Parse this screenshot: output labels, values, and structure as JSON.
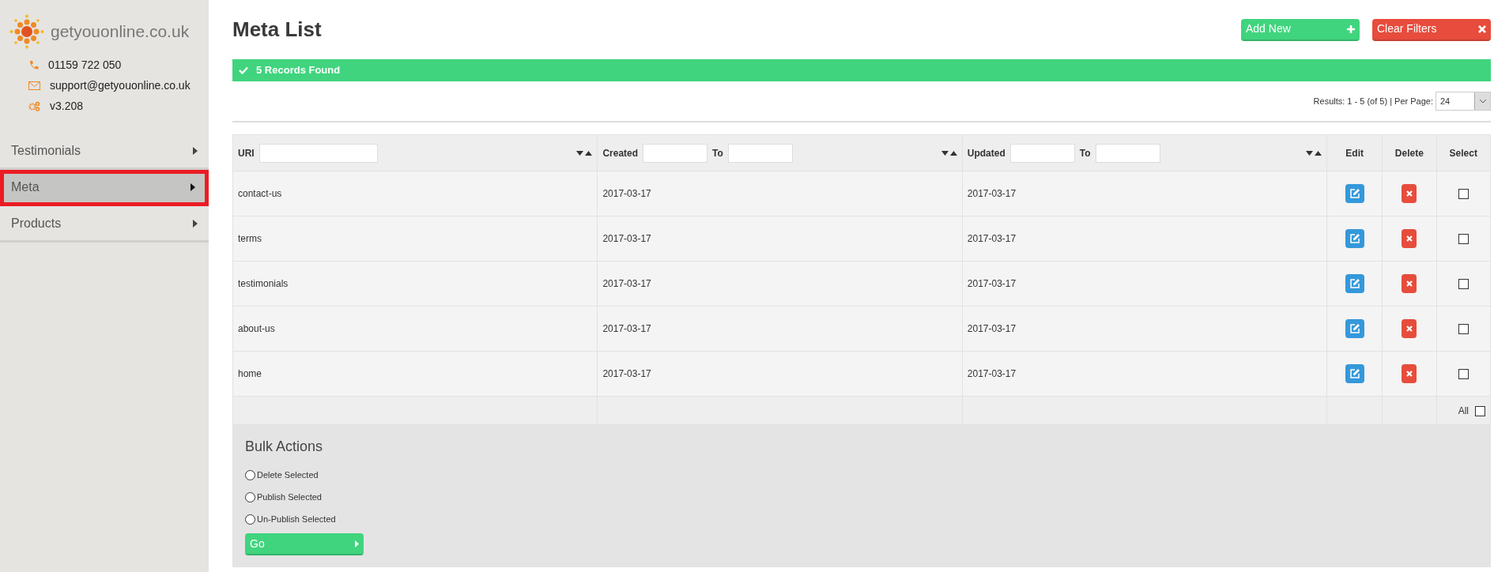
{
  "sidebar": {
    "brand": "getyouonline.co.uk",
    "contacts": [
      {
        "kind": "phone",
        "text": "01159 722 050"
      },
      {
        "kind": "email",
        "text": "support@getyouonline.co.uk"
      },
      {
        "kind": "version",
        "text": "v3.208"
      }
    ],
    "items": [
      {
        "label": "Testimonials",
        "selected": false
      },
      {
        "label": "Meta",
        "selected": true
      },
      {
        "label": "Products",
        "selected": false
      }
    ]
  },
  "header": {
    "title": "Meta List",
    "buttons": [
      {
        "kind": "add",
        "label": "Add New"
      },
      {
        "kind": "clear",
        "label": "Clear Filters"
      }
    ],
    "alert": "5 Records Found",
    "results": "Results: 1 - 5 (of 5) | Per Page:",
    "per_page": "24"
  },
  "table": {
    "columns": [
      {
        "kind": "filter",
        "label": "URI"
      },
      {
        "kind": "range",
        "label": "Created",
        "to_label": "To"
      },
      {
        "kind": "range",
        "label": "Updated",
        "to_label": "To"
      },
      {
        "kind": "action",
        "label": "Edit"
      },
      {
        "kind": "action",
        "label": "Delete"
      },
      {
        "kind": "action",
        "label": "Select"
      }
    ],
    "rows": [
      {
        "uri": "contact-us",
        "created": "2017-03-17",
        "updated": "2017-03-17",
        "checked": false
      },
      {
        "uri": "terms",
        "created": "2017-03-17",
        "updated": "2017-03-17",
        "checked": false
      },
      {
        "uri": "testimonials",
        "created": "2017-03-17",
        "updated": "2017-03-17",
        "checked": false
      },
      {
        "uri": "about-us",
        "created": "2017-03-17",
        "updated": "2017-03-17",
        "checked": false
      },
      {
        "uri": "home",
        "created": "2017-03-17",
        "updated": "2017-03-17",
        "checked": false
      }
    ],
    "footer": {
      "all_label": "All",
      "all_checked": false
    }
  },
  "bulk": {
    "title": "Bulk Actions",
    "options": [
      {
        "label": "Delete Selected",
        "selected": false
      },
      {
        "label": "Publish Selected",
        "selected": false
      },
      {
        "label": "Un-Publish Selected",
        "selected": false
      }
    ],
    "go": "Go"
  }
}
